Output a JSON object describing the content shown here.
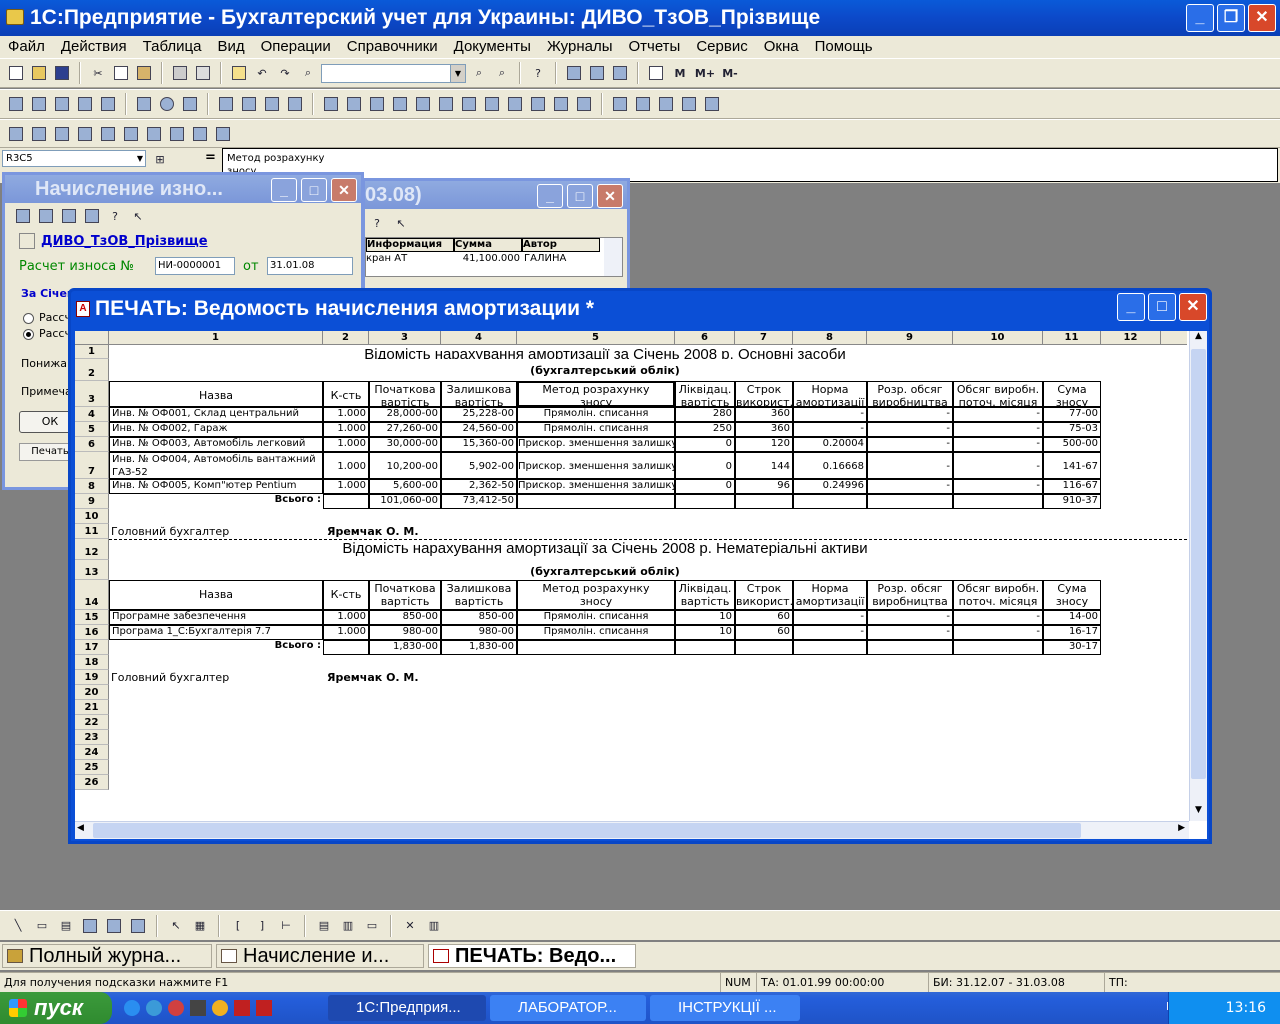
{
  "app": {
    "title": "1С:Предприятие - Бухгалтерский учет для Украины: ДИВО_ТзОВ_Прізвище"
  },
  "menu": [
    "Файл",
    "Действия",
    "Таблица",
    "Вид",
    "Операции",
    "Справочники",
    "Документы",
    "Журналы",
    "Отчеты",
    "Сервис",
    "Окна",
    "Помощь"
  ],
  "toolbar": {
    "m1": "M",
    "m2": "M+",
    "m3": "M-"
  },
  "formula": {
    "cellref": "R3C5",
    "text1": "Метод розрахунку",
    "text2": "зносу"
  },
  "depwin": {
    "title": "Начисление изно...",
    "company": "ДИВО_ТзОВ_Прізвище",
    "calc_label": "Расчет износа №",
    "doc_no": "НИ-0000001",
    "from": "от",
    "date": "31.01.08",
    "za": "За Січень",
    "r1": "Рассч",
    "r2": "Рассч",
    "lower": "Понижаю",
    "note": "Примечан",
    "ok": "ОК",
    "print": "Печать"
  },
  "journal": {
    "title_tail": "03.08)",
    "col1": "Информация",
    "col2": "Сумма",
    "col3": "Автор",
    "row_info": "кран АТ",
    "row_sum": "41,100.000",
    "row_author": "ГАЛИНА"
  },
  "print": {
    "title": "ПЕЧАТЬ: Ведомость начисления амортизации  *"
  },
  "sheet": {
    "colnums": [
      "1",
      "2",
      "3",
      "4",
      "5",
      "6",
      "7",
      "8",
      "9",
      "10",
      "11",
      "12"
    ],
    "title1": "Відомість нарахування амортизації за Січень 2008 р.  Основні засоби",
    "subtitle": "(бухгалтерський облік)",
    "title2": "Відомість нарахування амортизації за Січень 2008 р.  Нематеріальні активи",
    "headers": [
      [
        "Назва",
        ""
      ],
      [
        "К-сть",
        ""
      ],
      [
        "Початкова",
        "вартість"
      ],
      [
        "Залишкова",
        "вартість"
      ],
      [
        "Метод розрахунку",
        "зносу"
      ],
      [
        "Ліквідац.",
        "вартість"
      ],
      [
        "Строк",
        "використ."
      ],
      [
        "Норма",
        "амортизації"
      ],
      [
        "Розр. обсяг",
        "виробництва"
      ],
      [
        "Обсяг виробн.",
        "поточ. місяця"
      ],
      [
        "Сума",
        "зносу"
      ]
    ],
    "rows1": [
      [
        "Инв. № ОФ001, Склад центральний",
        "1.000",
        "28,000-00",
        "25,228-00",
        "Прямолін. списання",
        "280",
        "360",
        "-",
        "-",
        "-",
        "77-00"
      ],
      [
        "Инв. № ОФ002, Гараж",
        "1.000",
        "27,260-00",
        "24,560-00",
        "Прямолін. списання",
        "250",
        "360",
        "-",
        "-",
        "-",
        "75-03"
      ],
      [
        "Инв. № ОФ003, Автомобіль легковий",
        "1.000",
        "30,000-00",
        "15,360-00",
        "Прискор. зменшення залишку",
        "0",
        "120",
        "0.20004",
        "-",
        "-",
        "500-00"
      ],
      [
        "Инв. № ОФ004, Автомобіль вантажний ГАЗ-52",
        "1.000",
        "10,200-00",
        "5,902-00",
        "Прискор. зменшення залишку",
        "0",
        "144",
        "0.16668",
        "-",
        "-",
        "141-67"
      ],
      [
        "Инв. № ОФ005, Комп\"ютер Pentium",
        "1.000",
        "5,600-00",
        "2,362-50",
        "Прискор. зменшення залишку",
        "0",
        "96",
        "0.24996",
        "-",
        "-",
        "116-67"
      ]
    ],
    "total1": {
      "label": "Всього :",
      "initial": "101,060-00",
      "residual": "73,412-50",
      "sum": "910-37"
    },
    "rows2": [
      [
        "Програмне забезпечення",
        "1.000",
        "850-00",
        "850-00",
        "Прямолін. списання",
        "10",
        "60",
        "-",
        "-",
        "-",
        "14-00"
      ],
      [
        "Програма 1_С:Бухгалтерія 7.7",
        "1.000",
        "980-00",
        "980-00",
        "Прямолін. списання",
        "10",
        "60",
        "-",
        "-",
        "-",
        "16-17"
      ]
    ],
    "total2": {
      "label": "Всього :",
      "initial": "1,830-00",
      "residual": "1,830-00",
      "sum": "30-17"
    },
    "accountant_label": "Головний бухгалтер",
    "accountant_name": "Яремчак О. М."
  },
  "windows": [
    {
      "label": "Полный журна..."
    },
    {
      "label": "Начисление и..."
    },
    {
      "label": "ПЕЧАТЬ: Ведо..."
    }
  ],
  "status": {
    "hint": "Для получения подсказки нажмите F1",
    "num": "NUM",
    "ta": "ТА: 01.01.99  00:00:00",
    "bi": "БИ: 31.12.07 - 31.03.08",
    "tp": "ТП:"
  },
  "taskbar": {
    "start": "пуск",
    "t1": "1С:Предприя...",
    "t2": "ЛАБОРАТОР...",
    "t3": "ІНСТРУКЦІЇ ...",
    "lang": "EN",
    "clock": "13:16"
  }
}
